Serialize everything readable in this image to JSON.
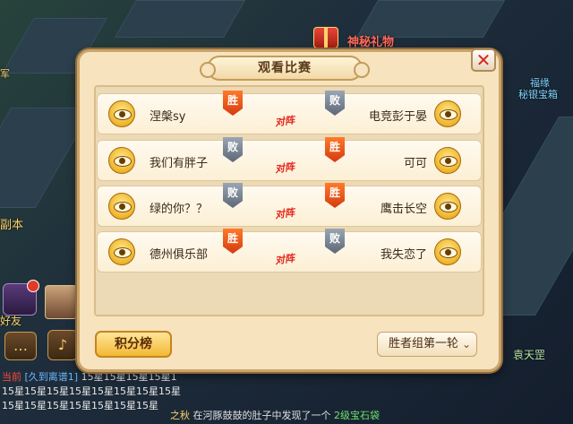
{
  "background": {
    "gift_label": "神秘礼物",
    "fuyuan_label": "福缘",
    "bank_label": "秘银宝箱",
    "dungeon_label": "副本",
    "jun_label": "军",
    "friend_label": "好友",
    "npc_label": "袁天罡",
    "chat": {
      "line1_tag": "当前",
      "line1_name": "[久到离谱1]",
      "line1_text": "15星15星15星15星1",
      "line2_text": "15星15星15星15星15星15星15星15星",
      "line3_text": "15星15星15星15星15星15星15星"
    },
    "bottom_msg": {
      "name": "之秋",
      "text": "在河豚鼓鼓的肚子中发现了一个",
      "item": "2级宝石袋"
    }
  },
  "dialog": {
    "title": "观看比赛",
    "close_label": "✕",
    "vs_label": "对阵",
    "win_label": "胜",
    "lose_label": "败",
    "matches": [
      {
        "left": "涅槃sy",
        "right": "电竞彭于晏",
        "left_result": "胜",
        "right_result": "败"
      },
      {
        "left": "我们有胖子",
        "right": "可可",
        "left_result": "败",
        "right_result": "胜"
      },
      {
        "left": "绿的你？？",
        "right": "鹰击长空",
        "left_result": "败",
        "right_result": "胜"
      },
      {
        "left": "德州俱乐部",
        "right": "我失恋了",
        "left_result": "胜",
        "right_result": "败"
      }
    ],
    "rank_button": "积分榜",
    "round_select": "胜者组第一轮",
    "round_arrow": "⌄"
  },
  "colors": {
    "win": "#d43a10",
    "lose": "#5c6877",
    "panel": "#f7e3bd",
    "accent": "#f3b934"
  }
}
